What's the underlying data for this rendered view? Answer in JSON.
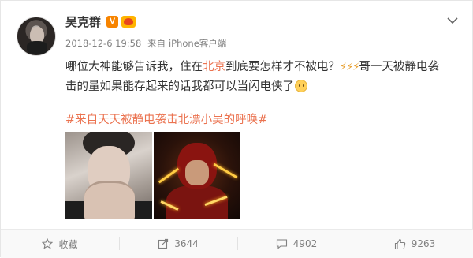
{
  "post": {
    "author": "吴克群",
    "verified_badge": "V",
    "time": "2018-12-6 19:58",
    "source_prefix": "来自",
    "device": "iPhone客户端",
    "content": {
      "part1": "哪位大神能够告诉我，住在",
      "location": "北京",
      "part2": "到底要怎样才不被电？",
      "zap": "⚡⚡⚡",
      "part3": "哥一天被静电袭击的量如果能存起来的话我都可以当闪电侠了"
    },
    "topic": "#来自天天被静电袭击北漂小吴的呼唤#",
    "images": [
      "photo-man-covering-mouth",
      "photo-the-flash"
    ]
  },
  "actions": {
    "favorite_label": "收藏",
    "repost_count": "3644",
    "comment_count": "4902",
    "like_count": "9263"
  },
  "colors": {
    "link": "#eb7350",
    "verified": "#f78400",
    "text": "#333333",
    "meta": "#808080"
  },
  "icons": {
    "menu": "chevron-down-icon",
    "favorite": "star-icon",
    "repost": "repost-icon",
    "comment": "comment-icon",
    "like": "thumbs-up-icon"
  }
}
